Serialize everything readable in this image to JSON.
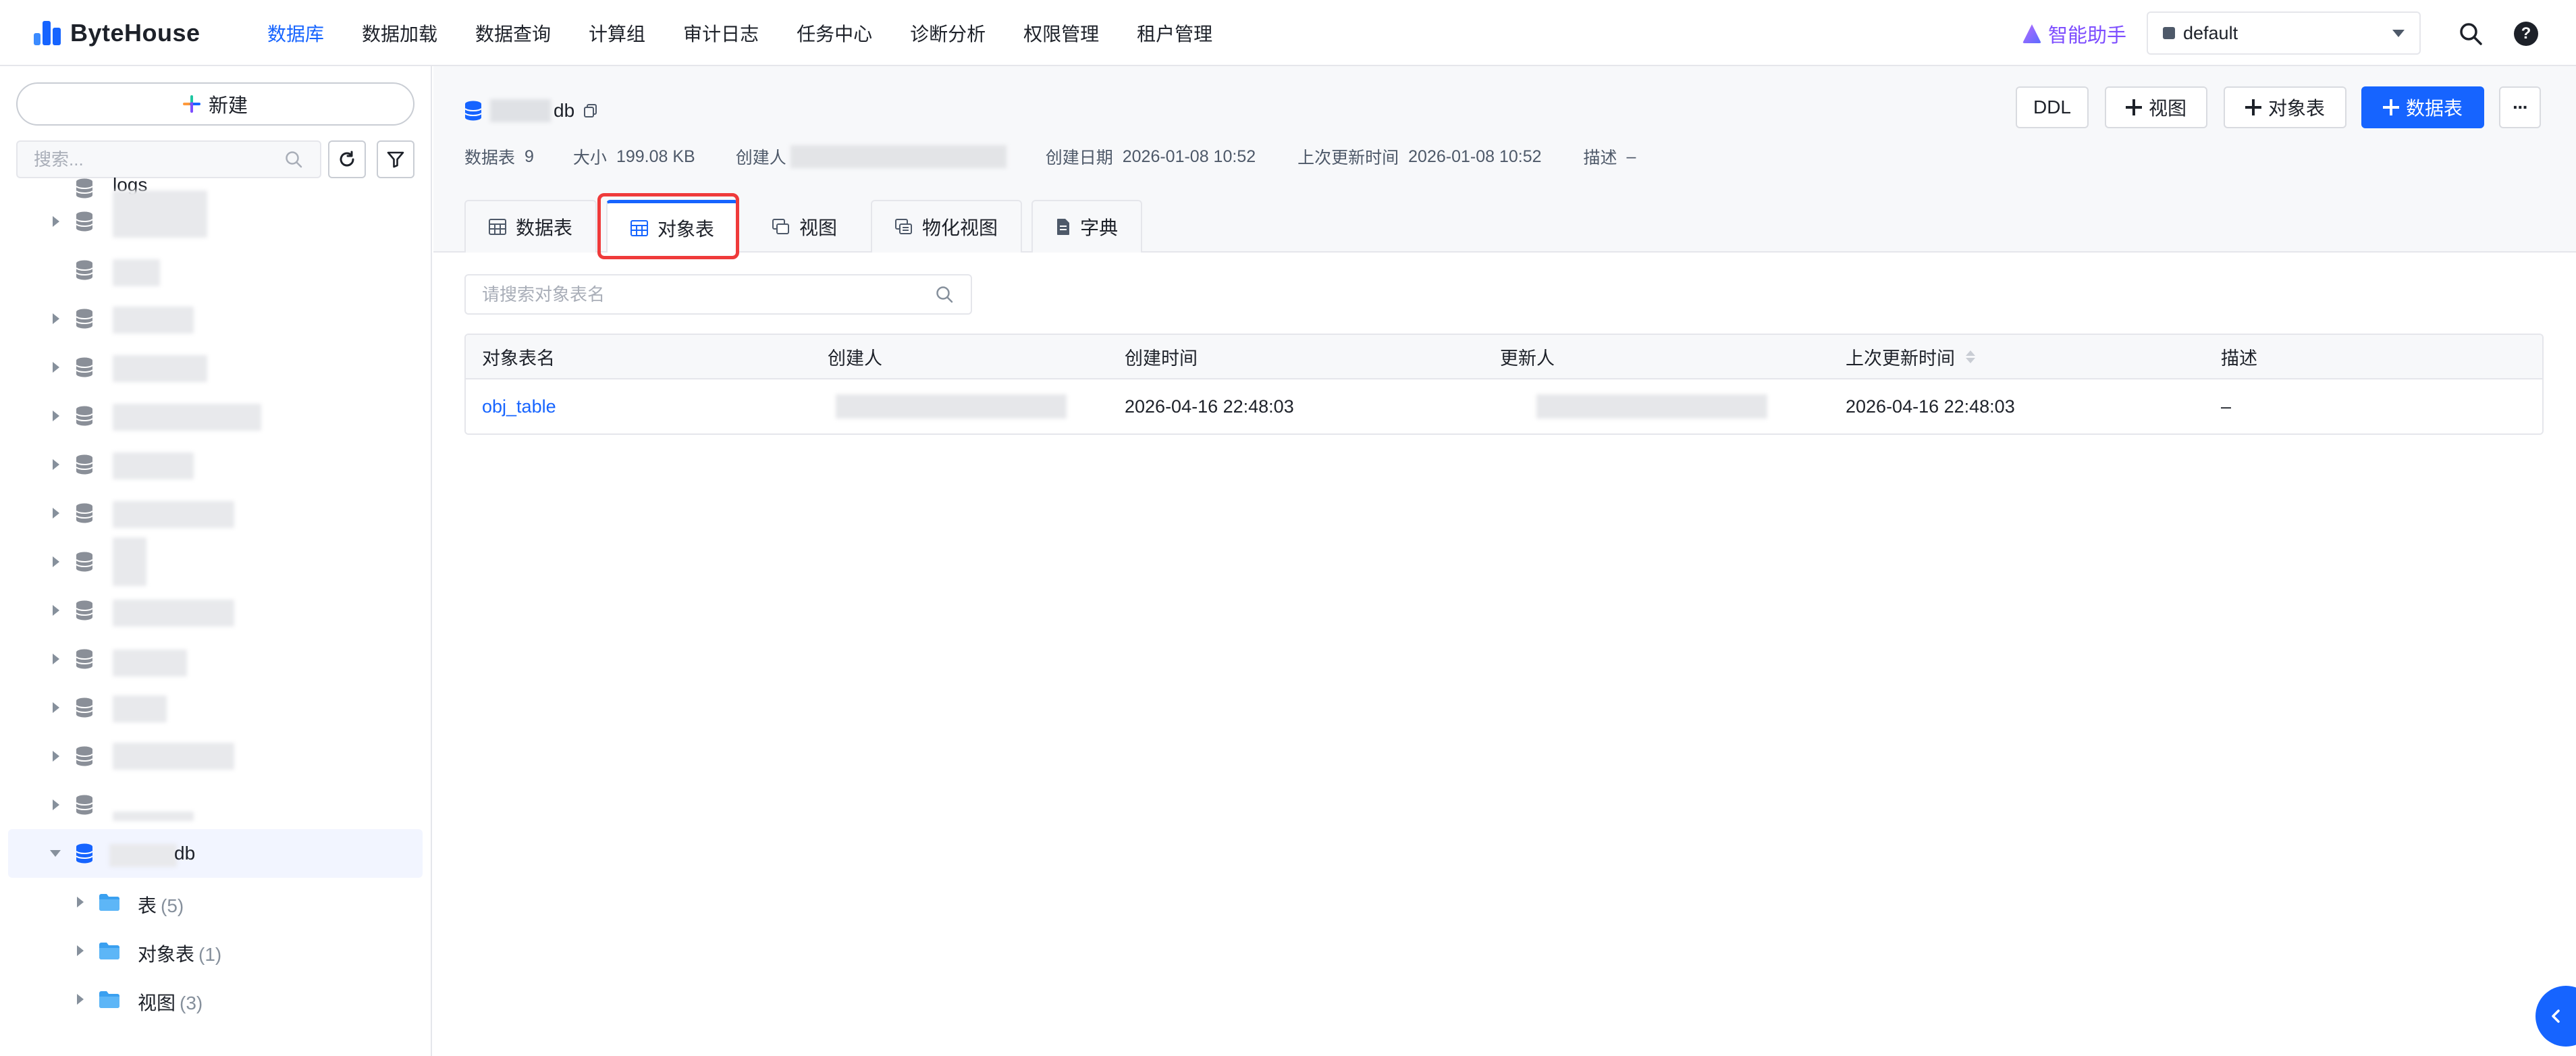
{
  "app": {
    "brand": "ByteHouse",
    "nav": [
      "数据库",
      "数据加载",
      "数据查询",
      "计算组",
      "审计日志",
      "任务中心",
      "诊断分析",
      "权限管理",
      "租户管理"
    ],
    "assistant_label": "智能助手",
    "workspace": "default"
  },
  "sidebar": {
    "new_label": "新建",
    "search_placeholder": "搜索...",
    "partial_top_label": "logs",
    "selected_db_suffix": "db",
    "children": [
      {
        "label": "表",
        "count": "(5)"
      },
      {
        "label": "对象表",
        "count": "(1)"
      },
      {
        "label": "视图",
        "count": "(3)"
      }
    ]
  },
  "header": {
    "db_name_suffix": "db",
    "meta": {
      "tables_label": "数据表",
      "tables_value": "9",
      "size_label": "大小",
      "size_value": "199.08 KB",
      "creator_label": "创建人",
      "created_label": "创建日期",
      "created_value": "2026-01-08 10:52",
      "updated_label": "上次更新时间",
      "updated_value": "2026-01-08 10:52",
      "desc_label": "描述",
      "desc_value": "–"
    },
    "buttons": {
      "ddl": "DDL",
      "view": "视图",
      "object_table": "对象表",
      "data_table": "数据表",
      "more": "···"
    }
  },
  "tabs": [
    {
      "label": "数据表"
    },
    {
      "label": "对象表"
    },
    {
      "label": "视图"
    },
    {
      "label": "物化视图"
    },
    {
      "label": "字典"
    }
  ],
  "object_tables": {
    "search_placeholder": "请搜索对象表名",
    "columns": [
      "对象表名",
      "创建人",
      "创建时间",
      "更新人",
      "上次更新时间",
      "描述"
    ],
    "rows": [
      {
        "name": "obj_table",
        "created_at": "2026-04-16 22:48:03",
        "updated_at": "2026-04-16 22:48:03",
        "description": "–"
      }
    ]
  },
  "colors": {
    "accent": "#1664ff",
    "highlight": "#ef3a3a",
    "assistant": "#7d4dff"
  }
}
